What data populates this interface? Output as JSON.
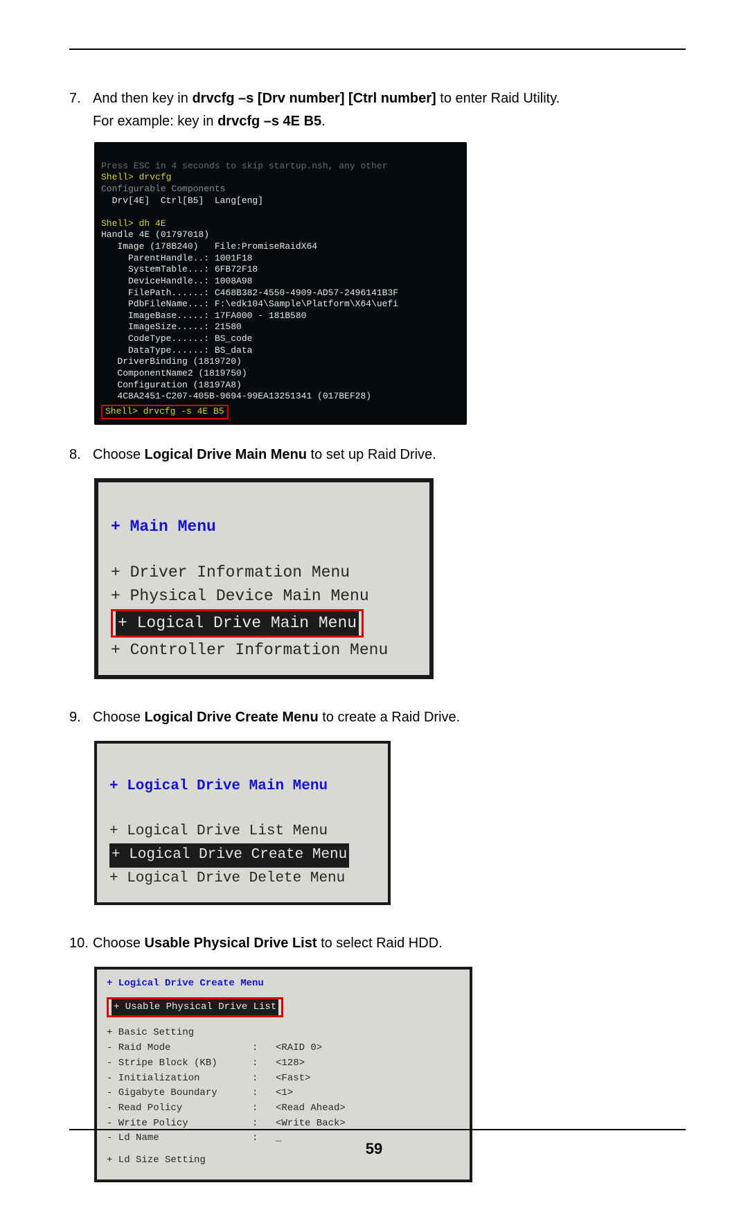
{
  "page_number": "59",
  "steps": {
    "s7": {
      "num": "7.",
      "pre": "And then key in ",
      "bold1": "drvcfg –s [Drv number] [Ctrl number]",
      "post1": " to enter Raid Utility.",
      "line2a": "For example: key in ",
      "bold2": "drvcfg –s 4E B5",
      "line2b": "."
    },
    "s8": {
      "num": "8.",
      "pre": "Choose ",
      "bold": "Logical Drive Main Menu",
      "post": " to set up Raid Drive."
    },
    "s9": {
      "num": "9.",
      "pre": "Choose ",
      "bold": "Logical Drive Create Menu",
      "post": " to create a Raid Drive."
    },
    "s10": {
      "num": "10.",
      "pre": "Choose ",
      "bold": "Usable Physical Drive List",
      "post": " to select Raid HDD."
    }
  },
  "terminal": {
    "l0": "Press ESC in 4 seconds to skip startup.nsh, any other",
    "l1": "Shell> drvcfg",
    "l2": "Configurable Components",
    "l3": "  Drv[4E]  Ctrl[B5]  Lang[eng]",
    "blank": " ",
    "l4": "Shell> dh 4E",
    "l5": "Handle 4E (01797018)",
    "l6": "   Image (178B240)   File:PromiseRaidX64",
    "l7": "     ParentHandle..: 1001F18",
    "l8": "     SystemTable...: 6FB72F18",
    "l9": "     DeviceHandle..: 1008A98",
    "l10": "     FilePath......: C468B382-4550-4909-AD57-2496141B3F",
    "l11": "     PdbFileName...: F:\\edk104\\Sample\\Platform\\X64\\uefi",
    "l12": "     ImageBase.....: 17FA000 - 181B580",
    "l13": "     ImageSize.....: 21580",
    "l14": "     CodeType......: BS_code",
    "l15": "     DataType......: BS_data",
    "l16": "   DriverBinding (1819720)",
    "l17": "   ComponentName2 (1819750)",
    "l18": "   Configuration (18197A8)",
    "l19": "   4C8A2451-C207-405B-9694-99EA13251341 (017BEF28)",
    "cmd": "Shell> drvcfg -s 4E B5"
  },
  "bios1": {
    "title": "+ Main Menu",
    "i1": "+ Driver Information Menu",
    "i2": "+ Physical Device Main Menu",
    "i3": "+ Logical Drive Main Menu",
    "i4": "+ Controller Information Menu"
  },
  "bios2": {
    "title": "+ Logical Drive Main Menu",
    "i1": "+ Logical Drive List Menu",
    "i2": "+ Logical Drive Create Menu",
    "i3": "+ Logical Drive Delete Menu"
  },
  "bios3": {
    "title": "+ Logical Drive Create Menu",
    "sel": "+ Usable Physical Drive List",
    "basic": "+ Basic Setting",
    "rows": [
      {
        "k": "- Raid Mode",
        "v": "<RAID 0>"
      },
      {
        "k": "- Stripe Block (KB)",
        "v": "<128>"
      },
      {
        "k": "- Initialization",
        "v": "<Fast>"
      },
      {
        "k": "- Gigabyte Boundary",
        "v": "<1>"
      },
      {
        "k": "- Read Policy",
        "v": "<Read Ahead>"
      },
      {
        "k": "- Write Policy",
        "v": "<Write Back>"
      },
      {
        "k": "- Ld Name",
        "v": "_"
      }
    ],
    "footer": "+ Ld Size Setting"
  }
}
